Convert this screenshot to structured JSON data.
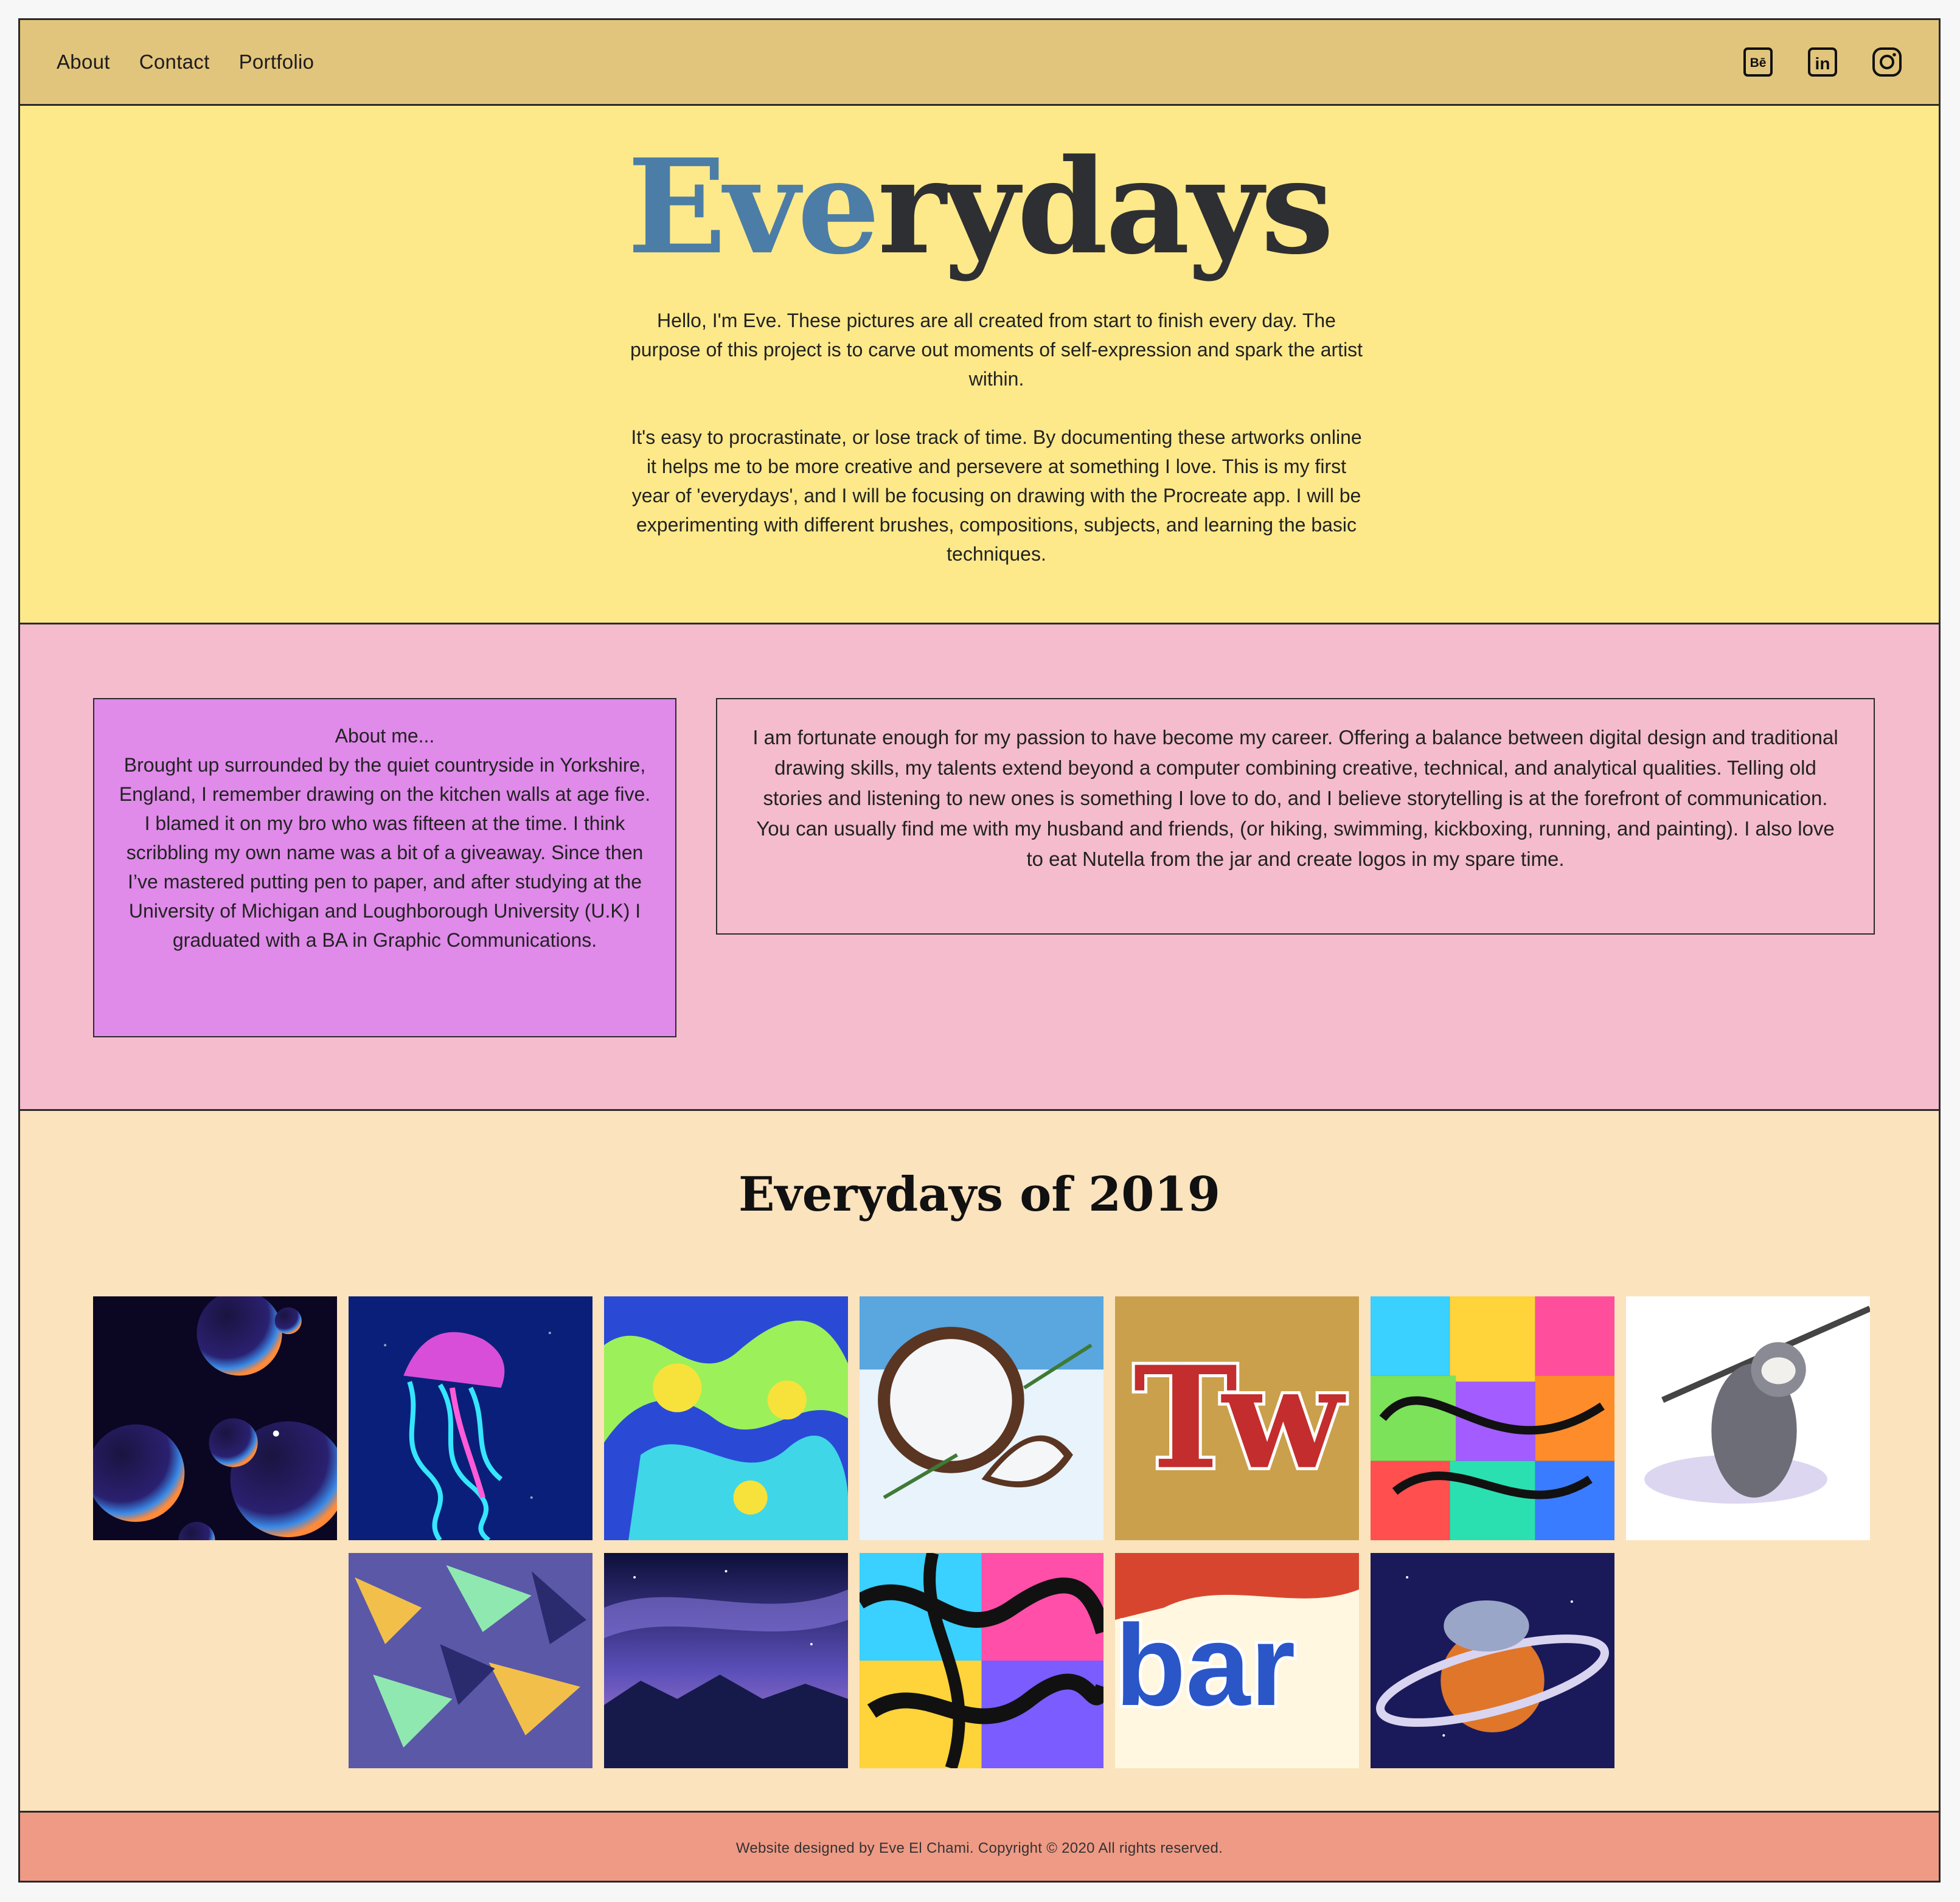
{
  "nav": {
    "links": [
      "About",
      "Contact",
      "Portfolio"
    ],
    "social": [
      {
        "icon": "behance-icon",
        "label": "Bē"
      },
      {
        "icon": "linkedin-icon",
        "label": "in"
      },
      {
        "icon": "instagram-icon",
        "label": ""
      }
    ]
  },
  "hero": {
    "title_accent": "Eve",
    "title_rest": "rydays",
    "intro": "Hello, I'm Eve. These pictures are all created from start to finish every day. The purpose of this project is to carve out moments of self-expression and spark the artist within.",
    "body": "It's easy to procrastinate, or lose track of time. By documenting these artworks online it helps me to be more creative and persevere at something I love. This is my first year of 'everydays', and I will be focusing on drawing with the Procreate app. I will be experimenting with different brushes, compositions, subjects, and learning the basic techniques."
  },
  "about": {
    "heading": "About me...",
    "text": "Brought up surrounded by the quiet countryside in Yorkshire, England, I remember drawing on the kitchen walls at age five. I blamed it on my bro who was fifteen at the time. I think scribbling my own name was a bit of a giveaway. Since then I’ve mastered putting pen to paper, and after studying at the University of Michigan and Loughborough University (U.K) I graduated with a BA in Graphic Communications.",
    "story": "I am fortunate enough for my passion to have become my career. Offering a balance between digital design and traditional drawing skills, my talents extend beyond a computer combining creative, technical, and analytical qualities. Telling old stories and listening to new ones is something I love to do, and I believe storytelling is at the forefront of communication. You can usually find me with my husband and friends, (or hiking, swimming, kickboxing, running, and painting). I also love to eat Nutella from the jar and create logos in my spare time."
  },
  "gallery": {
    "title": "Everydays of 2019",
    "artworks": [
      {
        "name": "bubbles-artwork",
        "tile_text": ""
      },
      {
        "name": "jellyfish-artwork",
        "tile_text": ""
      },
      {
        "name": "marble-swirl-artwork",
        "tile_text": ""
      },
      {
        "name": "coconut-artwork",
        "tile_text": ""
      },
      {
        "name": "twix-artwork",
        "tile_text": "Tw"
      },
      {
        "name": "rainbow-pattern-artwork",
        "tile_text": ""
      },
      {
        "name": "sloth-sketch-artwork",
        "tile_text": ""
      },
      {
        "name": "brushstroke-pattern-artwork",
        "tile_text": ""
      },
      {
        "name": "night-sky-artwork",
        "tile_text": ""
      },
      {
        "name": "ink-swirl-artwork",
        "tile_text": ""
      },
      {
        "name": "yorkie-bar-artwork",
        "tile_text": "bar"
      },
      {
        "name": "sloth-planet-artwork",
        "tile_text": ""
      }
    ]
  },
  "footer": {
    "text": "Website designed by Eve El Chami. Copyright © 2020 All rights reserved."
  },
  "colors": {
    "nav_bg": "#e2c57c",
    "hero_bg": "#fde98a",
    "title_accent": "#4b7da6",
    "about_bg": "#f4bccd",
    "about_card_bg": "#e08aea",
    "gallery_bg": "#fae3bd",
    "footer_bg": "#ef9a85"
  }
}
